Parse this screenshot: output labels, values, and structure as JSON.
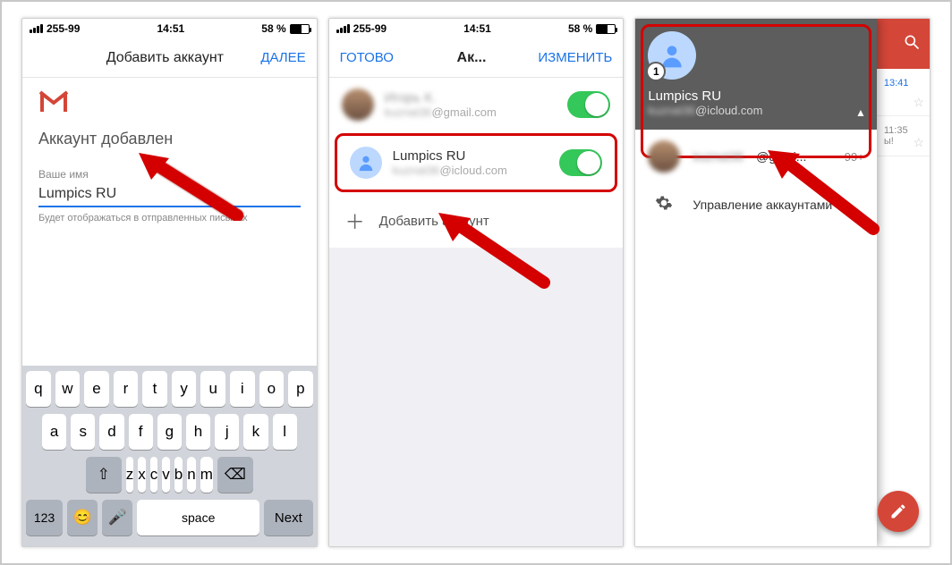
{
  "status": {
    "carrier": "255-99",
    "time": "14:51",
    "battery": "58 %"
  },
  "phone1": {
    "nav": {
      "title": "Добавить аккаунт",
      "next": "ДАЛЕЕ"
    },
    "added": "Аккаунт добавлен",
    "name_label": "Ваше имя",
    "name_value": "Lumpics RU",
    "helper": "Будет отображаться в отправленных письмах",
    "keyboard": {
      "row1": [
        "q",
        "w",
        "e",
        "r",
        "t",
        "y",
        "u",
        "i",
        "o",
        "p"
      ],
      "row2": [
        "a",
        "s",
        "d",
        "f",
        "g",
        "h",
        "j",
        "k",
        "l"
      ],
      "row3": [
        "z",
        "x",
        "c",
        "v",
        "b",
        "n",
        "m"
      ],
      "shift": "⇧",
      "backspace": "⌫",
      "num": "123",
      "emoji": "😊",
      "mic": "🎤",
      "space": "space",
      "next": "Next"
    }
  },
  "phone2": {
    "nav": {
      "done": "ГОТОВО",
      "title": "Ак...",
      "edit": "ИЗМЕНИТЬ"
    },
    "accounts": [
      {
        "name": "Игорь К.",
        "email": "@gmail.com",
        "on": true,
        "blurred": true
      },
      {
        "name": "Lumpics RU",
        "email_prefix": "kuznat36",
        "email_suffix": "@icloud.com",
        "on": true,
        "highlighted": true
      }
    ],
    "add": "Добавить аккаунт"
  },
  "phone3": {
    "drawer": {
      "badge": "1",
      "name": "Lumpics RU",
      "email_prefix": "kuznat36",
      "email_suffix": "@icloud.com",
      "other_account": "@gmai...",
      "other_count": "99+",
      "manage": "Управление аккаунтами"
    },
    "inbox": {
      "times": [
        "13:41",
        "11:35"
      ],
      "snip": "ы!"
    }
  }
}
